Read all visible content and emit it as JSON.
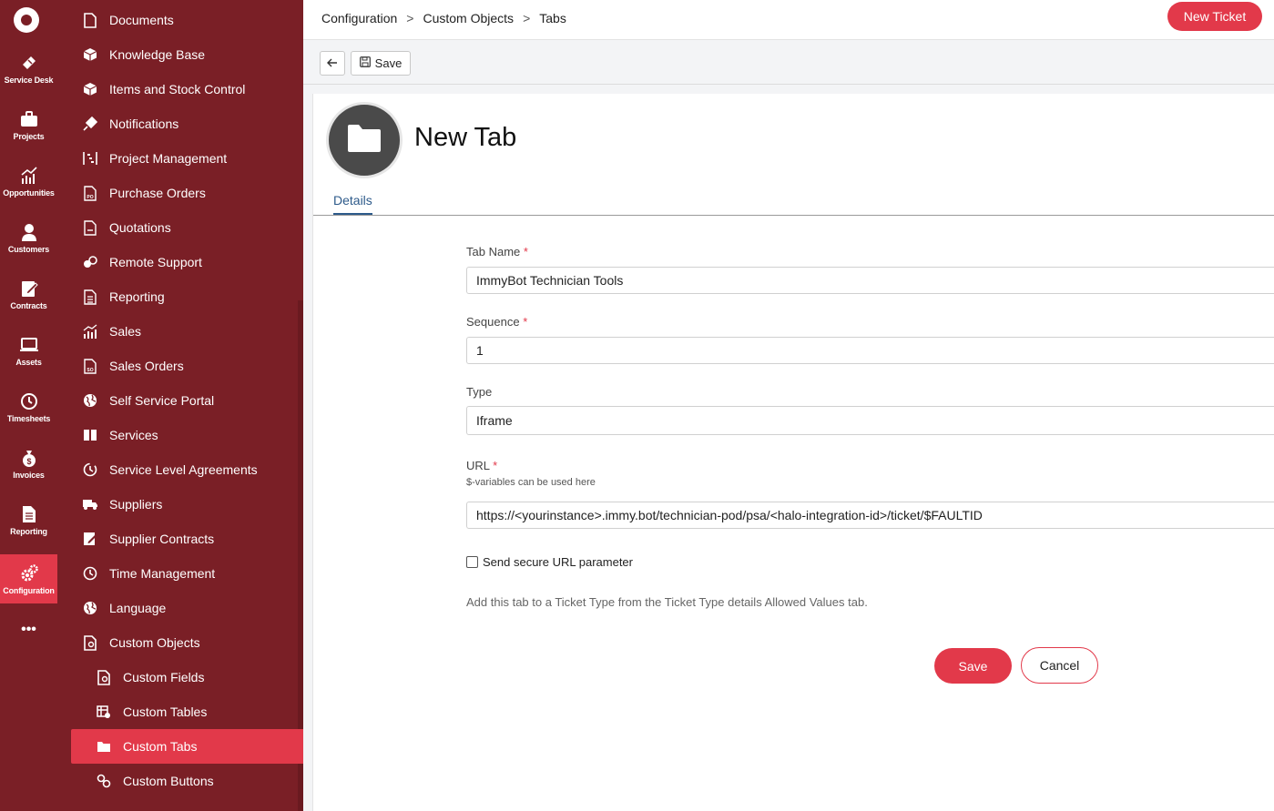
{
  "rail": {
    "items": [
      {
        "label": "Service Desk",
        "icon": "ticket-icon"
      },
      {
        "label": "Projects",
        "icon": "briefcase-icon"
      },
      {
        "label": "Opportunities",
        "icon": "chart-growth-icon"
      },
      {
        "label": "Customers",
        "icon": "person-icon"
      },
      {
        "label": "Contracts",
        "icon": "edit-document-icon"
      },
      {
        "label": "Assets",
        "icon": "laptop-icon"
      },
      {
        "label": "Timesheets",
        "icon": "clock-icon"
      },
      {
        "label": "Invoices",
        "icon": "money-bag-icon"
      },
      {
        "label": "Reporting",
        "icon": "report-icon"
      },
      {
        "label": "Configuration",
        "icon": "gears-icon"
      }
    ],
    "more": "•••"
  },
  "sidebar": {
    "items": [
      {
        "label": "Documents",
        "icon": "document-icon"
      },
      {
        "label": "Knowledge Base",
        "icon": "cube-icon"
      },
      {
        "label": "Items and Stock Control",
        "icon": "box-icon"
      },
      {
        "label": "Notifications",
        "icon": "megaphone-icon"
      },
      {
        "label": "Project Management",
        "icon": "gantt-icon"
      },
      {
        "label": "Purchase Orders",
        "icon": "po-document-icon"
      },
      {
        "label": "Quotations",
        "icon": "quote-document-icon"
      },
      {
        "label": "Remote Support",
        "icon": "remote-icon"
      },
      {
        "label": "Reporting",
        "icon": "report-icon"
      },
      {
        "label": "Sales",
        "icon": "chart-growth-icon"
      },
      {
        "label": "Sales Orders",
        "icon": "so-document-icon"
      },
      {
        "label": "Self Service Portal",
        "icon": "globe-icon"
      },
      {
        "label": "Services",
        "icon": "book-icon"
      },
      {
        "label": "Service Level Agreements",
        "icon": "timer-icon"
      },
      {
        "label": "Suppliers",
        "icon": "truck-icon"
      },
      {
        "label": "Supplier Contracts",
        "icon": "edit-document-icon"
      },
      {
        "label": "Time Management",
        "icon": "clock-icon"
      },
      {
        "label": "Language",
        "icon": "globe-icon"
      },
      {
        "label": "Custom Objects",
        "icon": "custom-object-icon"
      }
    ],
    "sub_items": [
      {
        "label": "Custom Fields",
        "icon": "custom-field-icon"
      },
      {
        "label": "Custom Tables",
        "icon": "table-icon"
      },
      {
        "label": "Custom Tabs",
        "icon": "folder-icon"
      },
      {
        "label": "Custom Buttons",
        "icon": "link-icon"
      }
    ]
  },
  "header": {
    "breadcrumb": [
      "Configuration",
      "Custom Objects",
      "Tabs"
    ],
    "separator": ">",
    "new_ticket": "New Ticket"
  },
  "toolbar": {
    "save_label": "Save"
  },
  "form": {
    "title": "New Tab",
    "tab": "Details",
    "tab_name_label": "Tab Name",
    "tab_name_value": "ImmyBot Technician Tools",
    "sequence_label": "Sequence",
    "sequence_value": "1",
    "type_label": "Type",
    "type_value": "Iframe",
    "url_label": "URL",
    "url_hint": "$-variables can be used here",
    "url_value": "https://<yourinstance>.immy.bot/technician-pod/psa/<halo-integration-id>/ticket/$FAULTID",
    "secure_label": "Send secure URL parameter",
    "secure_checked": false,
    "note": "Add this tab to a Ticket Type from the Ticket Type details Allowed Values tab.",
    "required_mark": "*",
    "save_button": "Save",
    "cancel_button": "Cancel"
  },
  "colors": {
    "brand_dark": "#7a1f26",
    "accent": "#e2394a",
    "tab_blue": "#2d5a8a"
  }
}
